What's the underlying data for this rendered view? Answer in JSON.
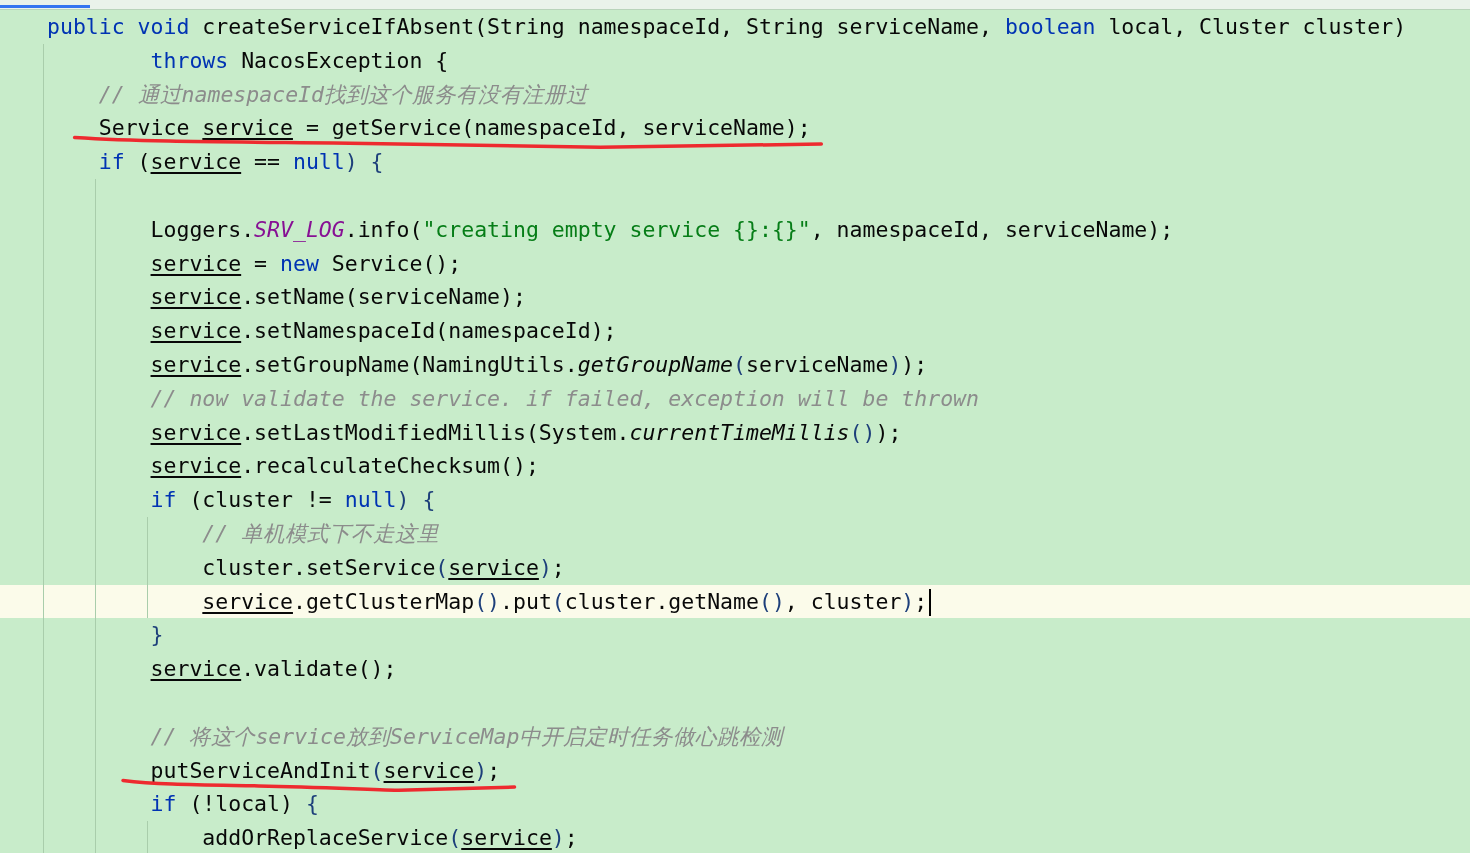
{
  "editor": {
    "lines": [
      {
        "tokens": [
          {
            "kind": "kw",
            "t": "public "
          },
          {
            "kind": "kw",
            "t": "void"
          },
          {
            "kind": "plain",
            "t": " createServiceIfAbsent(String namespaceId, String serviceName, "
          },
          {
            "kind": "kw",
            "t": "boolean"
          },
          {
            "kind": "plain",
            "t": " local, Cluster cluster)"
          }
        ]
      },
      {
        "kind": "continuation",
        "tokens": [
          {
            "kind": "kw",
            "t": "throws"
          },
          {
            "kind": "plain",
            "t": " NacosException {"
          }
        ],
        "children": [
          {
            "tokens": [
              {
                "kind": "comment",
                "t": "// 通过namespaceId找到这个服务有没有注册过"
              }
            ]
          },
          {
            "underlined": true,
            "tokens": [
              {
                "kind": "plain",
                "t": "Service "
              },
              {
                "kind": "var",
                "t": "service"
              },
              {
                "kind": "plain",
                "t": " = getService(namespaceId, serviceName);"
              }
            ]
          },
          {
            "tokens": [
              {
                "kind": "kw",
                "t": "if"
              },
              {
                "kind": "plain",
                "t": " ("
              },
              {
                "kind": "var",
                "t": "service"
              },
              {
                "kind": "plain",
                "t": " == "
              },
              {
                "kind": "kw",
                "t": "null"
              },
              {
                "kind": "brace",
                "t": ") {"
              }
            ],
            "children": [
              {
                "blank_before": true,
                "tokens": [
                  {
                    "kind": "plain",
                    "t": "Loggers."
                  },
                  {
                    "kind": "static_field",
                    "t": "SRV_LOG"
                  },
                  {
                    "kind": "plain",
                    "t": ".info("
                  },
                  {
                    "kind": "string",
                    "t": "\"creating empty service {}:{}\""
                  },
                  {
                    "kind": "plain",
                    "t": ", namespaceId, serviceName);"
                  }
                ]
              },
              {
                "tokens": [
                  {
                    "kind": "var",
                    "t": "service"
                  },
                  {
                    "kind": "plain",
                    "t": " = "
                  },
                  {
                    "kind": "kw",
                    "t": "new"
                  },
                  {
                    "kind": "plain",
                    "t": " Service();"
                  }
                ]
              },
              {
                "tokens": [
                  {
                    "kind": "var",
                    "t": "service"
                  },
                  {
                    "kind": "plain",
                    "t": ".setName(serviceName);"
                  }
                ]
              },
              {
                "tokens": [
                  {
                    "kind": "var",
                    "t": "service"
                  },
                  {
                    "kind": "plain",
                    "t": ".setNamespaceId(namespaceId);"
                  }
                ]
              },
              {
                "tokens": [
                  {
                    "kind": "var",
                    "t": "service"
                  },
                  {
                    "kind": "plain",
                    "t": ".setGroupName(NamingUtils."
                  },
                  {
                    "kind": "static_method",
                    "t": "getGroupName"
                  },
                  {
                    "kind": "brace",
                    "t": "("
                  },
                  {
                    "kind": "plain",
                    "t": "serviceName"
                  },
                  {
                    "kind": "brace",
                    "t": ")"
                  },
                  {
                    "kind": "plain",
                    "t": ");"
                  }
                ]
              },
              {
                "tokens": [
                  {
                    "kind": "comment",
                    "t": "// now validate the service. if failed, exception will be thrown"
                  }
                ]
              },
              {
                "tokens": [
                  {
                    "kind": "var",
                    "t": "service"
                  },
                  {
                    "kind": "plain",
                    "t": ".setLastModifiedMillis(System."
                  },
                  {
                    "kind": "static_method",
                    "t": "currentTimeMillis"
                  },
                  {
                    "kind": "brace",
                    "t": "()"
                  },
                  {
                    "kind": "plain",
                    "t": ");"
                  }
                ]
              },
              {
                "tokens": [
                  {
                    "kind": "var",
                    "t": "service"
                  },
                  {
                    "kind": "plain",
                    "t": ".recalculateChecksum();"
                  }
                ]
              },
              {
                "tokens": [
                  {
                    "kind": "kw",
                    "t": "if"
                  },
                  {
                    "kind": "plain",
                    "t": " (cluster != "
                  },
                  {
                    "kind": "kw",
                    "t": "null"
                  },
                  {
                    "kind": "brace",
                    "t": ") {"
                  }
                ],
                "children": [
                  {
                    "tokens": [
                      {
                        "kind": "comment",
                        "t": "// 单机模式下不走这里"
                      }
                    ]
                  },
                  {
                    "tokens": [
                      {
                        "kind": "plain",
                        "t": "cluster.setService"
                      },
                      {
                        "kind": "brace",
                        "t": "("
                      },
                      {
                        "kind": "var",
                        "t": "service"
                      },
                      {
                        "kind": "brace",
                        "t": ")"
                      },
                      {
                        "kind": "plain",
                        "t": ";"
                      }
                    ]
                  },
                  {
                    "current": true,
                    "caret": true,
                    "tokens": [
                      {
                        "kind": "var",
                        "t": "service"
                      },
                      {
                        "kind": "plain",
                        "t": ".getClusterMap"
                      },
                      {
                        "kind": "brace",
                        "t": "()"
                      },
                      {
                        "kind": "plain",
                        "t": ".put"
                      },
                      {
                        "kind": "brace",
                        "t": "("
                      },
                      {
                        "kind": "plain",
                        "t": "cluster.getName"
                      },
                      {
                        "kind": "brace",
                        "t": "()"
                      },
                      {
                        "kind": "plain",
                        "t": ", cluster"
                      },
                      {
                        "kind": "brace",
                        "t": ")"
                      },
                      {
                        "kind": "plain",
                        "t": ";"
                      }
                    ]
                  }
                ]
              },
              {
                "tokens": [
                  {
                    "kind": "brace",
                    "t": "}"
                  }
                ]
              },
              {
                "tokens": [
                  {
                    "kind": "var",
                    "t": "service"
                  },
                  {
                    "kind": "plain",
                    "t": ".validate();"
                  }
                ]
              },
              {
                "blank_before": true,
                "tokens": [
                  {
                    "kind": "comment",
                    "t": "// 将这个service放到ServiceMap中开启定时任务做心跳检测"
                  }
                ]
              },
              {
                "underlined": true,
                "tokens": [
                  {
                    "kind": "plain",
                    "t": "putServiceAndInit"
                  },
                  {
                    "kind": "brace",
                    "t": "("
                  },
                  {
                    "kind": "var",
                    "t": "service"
                  },
                  {
                    "kind": "brace",
                    "t": ")"
                  },
                  {
                    "kind": "plain",
                    "t": ";"
                  }
                ]
              },
              {
                "tokens": [
                  {
                    "kind": "kw",
                    "t": "if"
                  },
                  {
                    "kind": "plain",
                    "t": " (!local) "
                  },
                  {
                    "kind": "brace",
                    "t": "{"
                  }
                ],
                "children": [
                  {
                    "tokens": [
                      {
                        "kind": "plain",
                        "t": "addOrReplaceService"
                      },
                      {
                        "kind": "brace",
                        "t": "("
                      },
                      {
                        "kind": "var",
                        "t": "service"
                      },
                      {
                        "kind": "brace",
                        "t": ")"
                      },
                      {
                        "kind": "plain",
                        "t": ";"
                      }
                    ]
                  }
                ]
              }
            ]
          }
        ]
      }
    ]
  }
}
